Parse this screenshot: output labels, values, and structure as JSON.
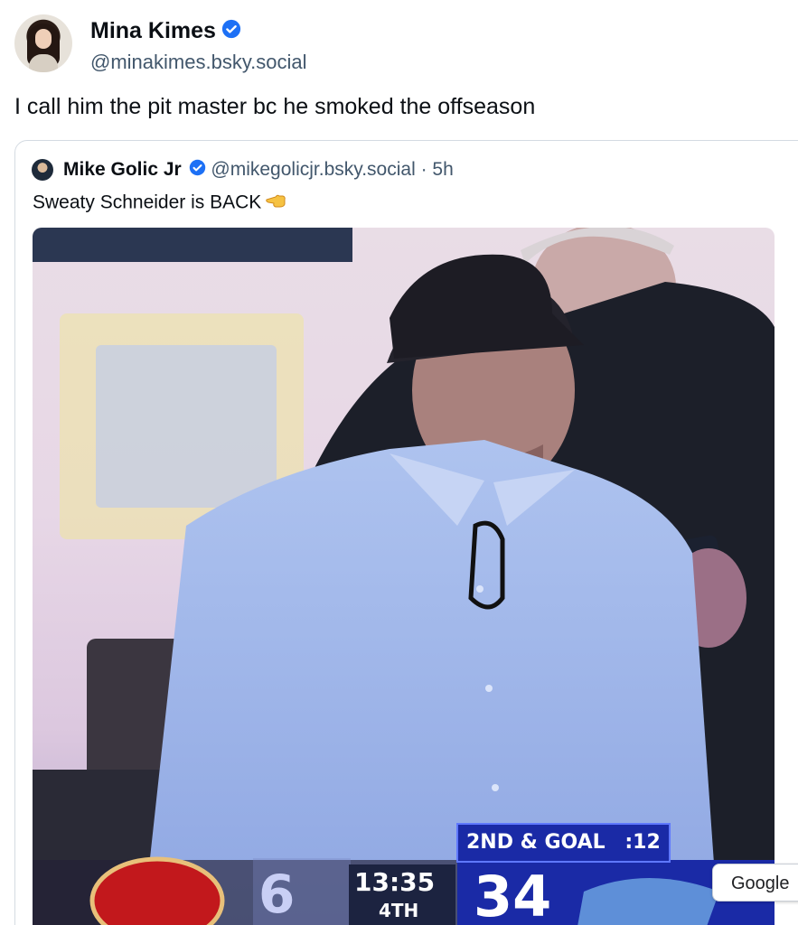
{
  "post": {
    "author_name": "Mina Kimes",
    "author_handle": "@minakimes.bsky.social",
    "text": "I call him the pit master bc he smoked the offseason"
  },
  "quoted_post": {
    "author_name": "Mike Golic Jr",
    "author_handle": "@mikegolicjr.bsky.social · 5h",
    "text": "Sweaty Schneider is BACK",
    "emoji_icon": "backhand-index-pointing-left-icon"
  },
  "scoreboard": {
    "situation": "2ND & GOAL",
    "play_clock": ":12",
    "away_score": "6",
    "clock": "13:35",
    "quarter": "4TH",
    "home_score": "34"
  },
  "overlay": {
    "google_label": "Google"
  },
  "colors": {
    "verified": "#1d70f5",
    "handle": "#42576c",
    "scoreboard_blue": "#1a2aa6"
  }
}
